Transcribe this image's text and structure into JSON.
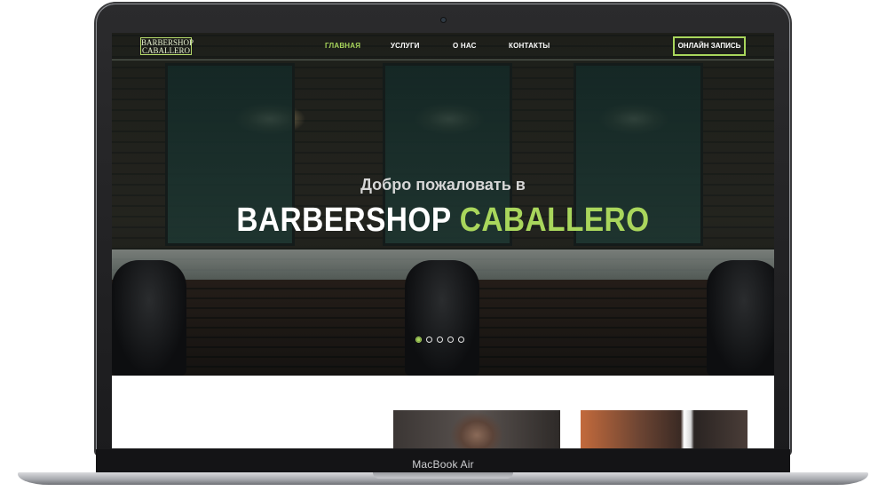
{
  "nav": {
    "logo_line1": "BARBERSHOP",
    "logo_line2": "CABALLERO",
    "links": [
      {
        "label": "ГЛАВНАЯ",
        "active": true
      },
      {
        "label": "УСЛУГИ",
        "active": false
      },
      {
        "label": "О НАС",
        "active": false
      },
      {
        "label": "КОНТАКТЫ",
        "active": false
      }
    ],
    "cta_label": "ОНЛАЙН ЗАПИСЬ"
  },
  "hero": {
    "welcome": "Добро пожаловать в",
    "title_white": "BARBERSHOP",
    "title_green": "CABALLERO",
    "slides": 5,
    "active_slide": 1
  },
  "device": {
    "label": "MacBook Air"
  },
  "colors": {
    "accent": "#a9d65c",
    "nav_text": "#ffffff"
  }
}
